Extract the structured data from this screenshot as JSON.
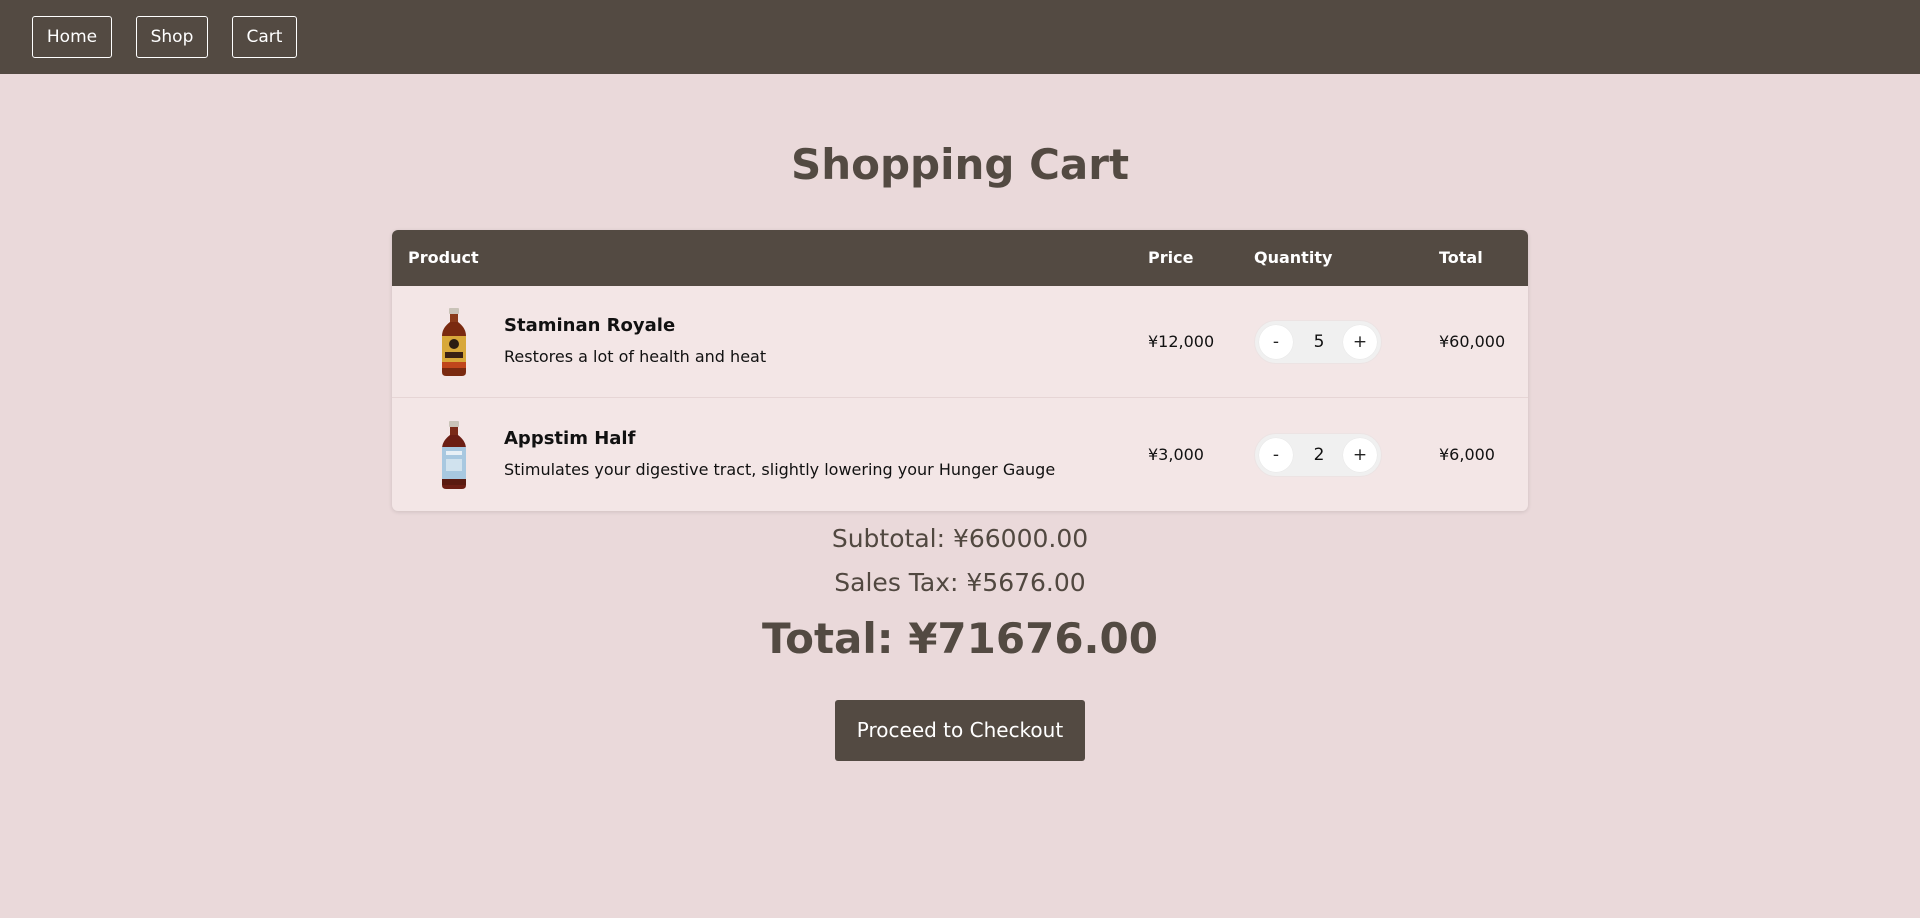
{
  "nav": {
    "items": [
      {
        "label": "Home"
      },
      {
        "label": "Shop"
      },
      {
        "label": "Cart"
      }
    ]
  },
  "page": {
    "title": "Shopping Cart"
  },
  "cart": {
    "headers": {
      "product": "Product",
      "price": "Price",
      "quantity": "Quantity",
      "total": "Total"
    },
    "items": [
      {
        "name": "Staminan Royale",
        "description": "Restores a lot of health and heat",
        "price": "¥12,000",
        "quantity": "5",
        "total": "¥60,000",
        "decrement_label": "-",
        "increment_label": "+",
        "image_icon": "bottle-icon",
        "bottle_color": "#7a2a10",
        "label_color": "#d8a83a"
      },
      {
        "name": "Appstim Half",
        "description": "Stimulates your digestive tract, slightly lowering your Hunger Gauge",
        "price": "¥3,000",
        "quantity": "2",
        "total": "¥6,000",
        "decrement_label": "-",
        "increment_label": "+",
        "image_icon": "bottle-icon",
        "bottle_color": "#6b1e14",
        "label_color": "#a8c8e0"
      }
    ]
  },
  "summary": {
    "subtotal": "Subtotal: ¥66000.00",
    "sales_tax": "Sales Tax: ¥5676.00",
    "total": "Total: ¥71676.00"
  },
  "checkout": {
    "label": "Proceed to Checkout"
  },
  "colors": {
    "background": "#ead9da",
    "accent": "#534a42",
    "card": "#f3e6e6"
  }
}
